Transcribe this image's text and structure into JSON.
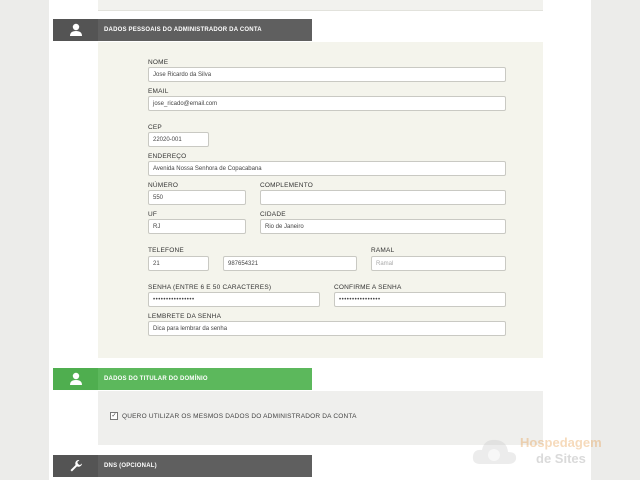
{
  "sections": {
    "admin": {
      "title": "DADOS PESSOAIS DO ADMINISTRADOR DA CONTA",
      "icon": "user-icon"
    },
    "titular": {
      "title": "DADOS DO TITULAR DO DOMÍNIO",
      "icon": "user-icon"
    },
    "dns": {
      "title": "DNS (OPCIONAL)",
      "icon": "wrench-icon"
    }
  },
  "form": {
    "nome": {
      "label": "NOME",
      "value": "Jose Ricardo da Silva"
    },
    "email": {
      "label": "EMAIL",
      "value": "jose_ricado@email.com"
    },
    "cep": {
      "label": "CEP",
      "value": "22020-001"
    },
    "endereco": {
      "label": "ENDEREÇO",
      "value": "Avenida Nossa Senhora de Copacabana"
    },
    "numero": {
      "label": "NÚMERO",
      "value": "550"
    },
    "complemento": {
      "label": "COMPLEMENTO",
      "value": ""
    },
    "uf": {
      "label": "UF",
      "value": "RJ"
    },
    "cidade": {
      "label": "CIDADE",
      "value": "Rio de Janeiro"
    },
    "telefone": {
      "label": "TELEFONE",
      "ddd": "21",
      "numero": "987654321"
    },
    "ramal": {
      "label": "RAMAL",
      "placeholder": "Ramal"
    },
    "senha": {
      "label": "SENHA (ENTRE 6 E 50 CARACTERES)",
      "value": "••••••••••••••••"
    },
    "confirme": {
      "label": "CONFIRME A SENHA",
      "value": "••••••••••••••••"
    },
    "lembrete": {
      "label": "LEMBRETE DA SENHA",
      "value": "Dica para lembrar da senha"
    }
  },
  "titular": {
    "checkbox_checked": true,
    "checkbox_label": "QUERO UTILIZAR OS MESMOS DADOS DO ADMINISTRADOR DA CONTA"
  },
  "watermark": {
    "line1": "Hospedagem",
    "line2": "de Sites"
  },
  "colors": {
    "gray_header": "#5f5f5f",
    "green_header": "#5cb85c",
    "panel_bg": "#f4f4ec"
  }
}
